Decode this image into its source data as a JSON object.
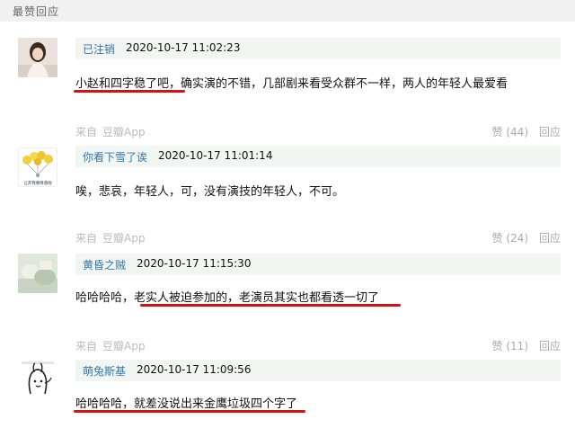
{
  "section": {
    "title": "最赞回应"
  },
  "comments": [
    {
      "username": "已注销",
      "timestamp": "2020-10-17 11:02:23",
      "text_highlight": "小赵和四字稳了吧",
      "text_rest": "，确实演的不错，几部剧来看受众群不一样，两人的年轻人最爱看",
      "source_prefix": "来自",
      "source_app": "豆瓣App",
      "vote_label": "赞 (44)",
      "reply_label": "回应"
    },
    {
      "username": "你看下雪了诶",
      "timestamp": "2020-10-17 11:01:14",
      "text": "唉，悲哀，年轻人，可，没有演技的年轻人，不可。",
      "avatar_caption": "让开我要降落啦",
      "source_prefix": "来自",
      "source_app": "豆瓣App",
      "vote_label": "赞 (24)",
      "reply_label": "回应"
    },
    {
      "username": "黄昏之贼",
      "timestamp": "2020-10-17 11:15:30",
      "text_prefix": "哈哈哈哈，",
      "text_highlight1": "老实人被迫参加的",
      "text_middle": "，",
      "text_highlight2": "老演员其实也都看透一切了",
      "source_prefix": "来自",
      "source_app": "豆瓣App",
      "vote_label": "赞 (11)",
      "reply_label": "回应"
    },
    {
      "username": "萌兔斯基",
      "timestamp": "2020-10-17 11:09:56",
      "text_highlight": "哈哈哈哈，就差没说出来金鹰垃圾四个字了"
    }
  ],
  "colors": {
    "link": "#3377aa",
    "meta_bg": "#f2f6f2",
    "underline": "#d41212",
    "muted": "#aaaaaa",
    "header_bg": "#f0f0f0"
  }
}
